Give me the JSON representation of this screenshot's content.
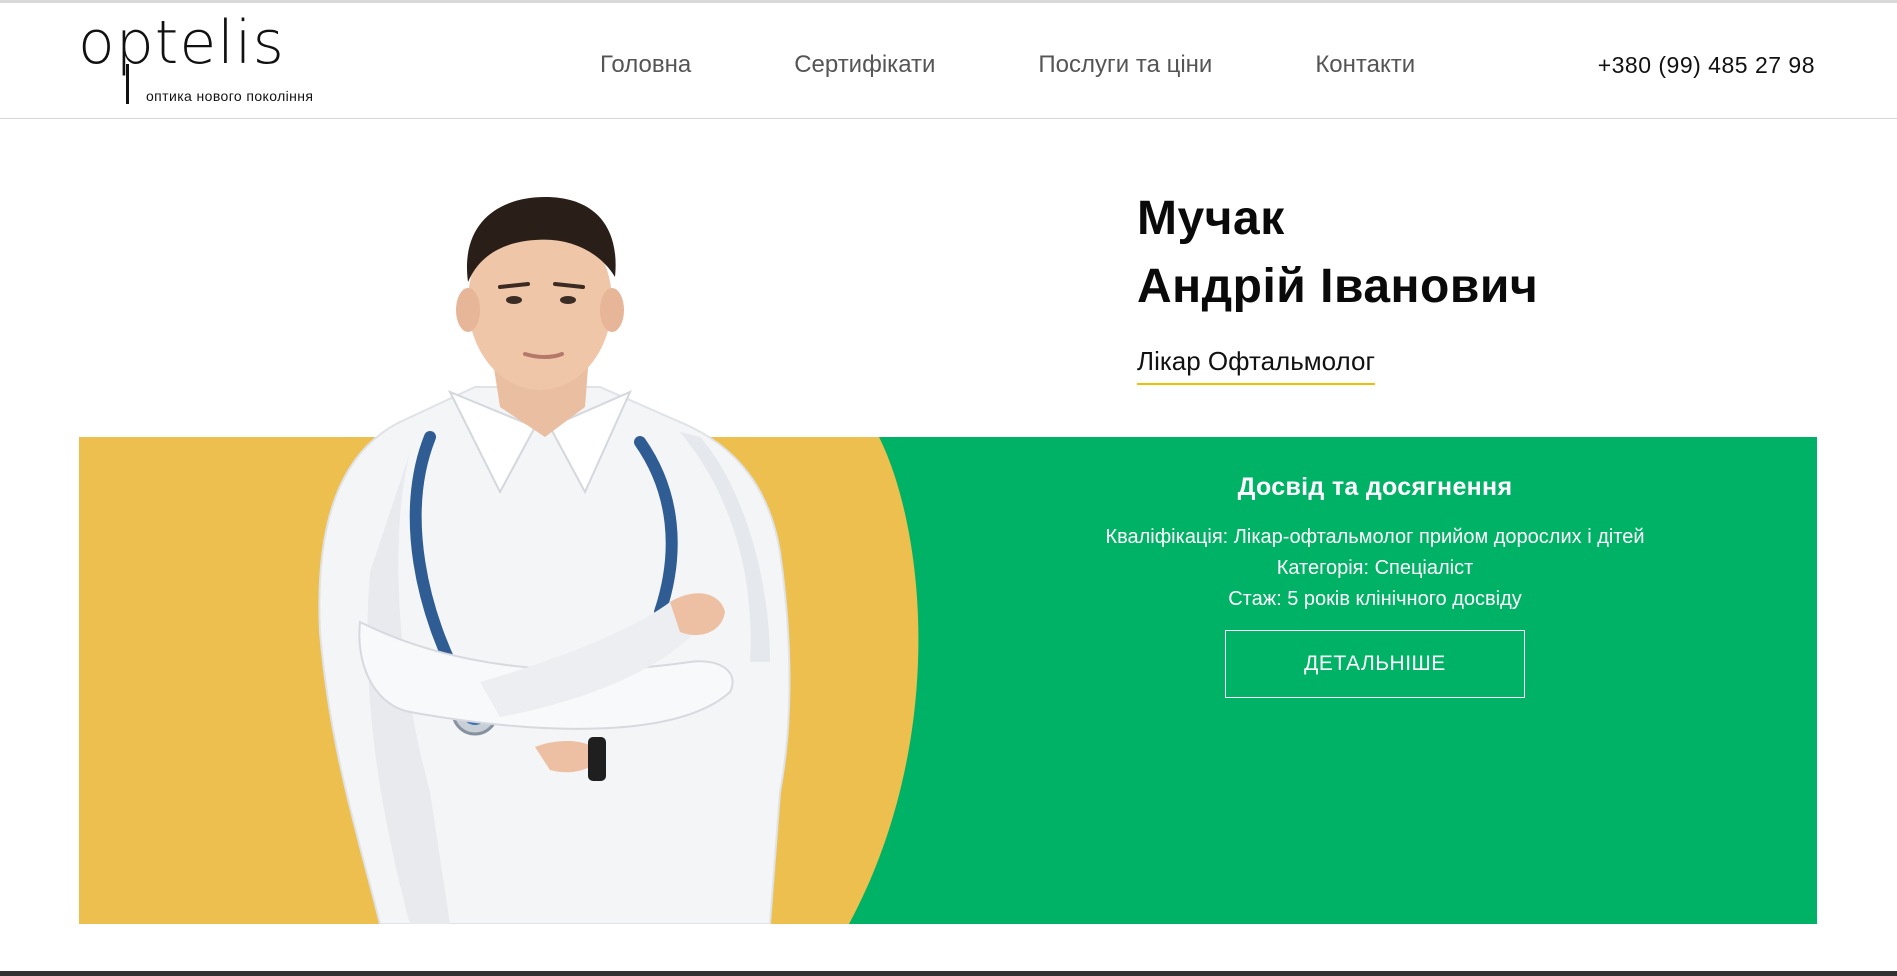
{
  "header": {
    "logo": {
      "word": "optelis",
      "tagline": "оптика нового покоління"
    },
    "nav": [
      {
        "label": "Головна"
      },
      {
        "label": "Сертифікати"
      },
      {
        "label": "Послуги та ціни"
      },
      {
        "label": "Контакти"
      }
    ],
    "phone": "+380 (99) 485 27 98"
  },
  "doctor": {
    "name_line1": "Мучак",
    "name_line2": "Андрій Іванович",
    "title": "Лікар Офтальмолог"
  },
  "experience": {
    "heading": "Досвід та досягнення",
    "qualification": "Кваліфікація: Лікар-офтальмолог прийом дорослих і дітей",
    "category": "Категорія: Спеціаліст",
    "tenure": "Стаж: 5 років клінічного досвіду",
    "button_label": "ДЕТАЛЬНІШЕ"
  },
  "colors": {
    "green_panel": "#00b265",
    "yellow_panel": "#edbf4f",
    "title_underline": "#f0c000"
  }
}
